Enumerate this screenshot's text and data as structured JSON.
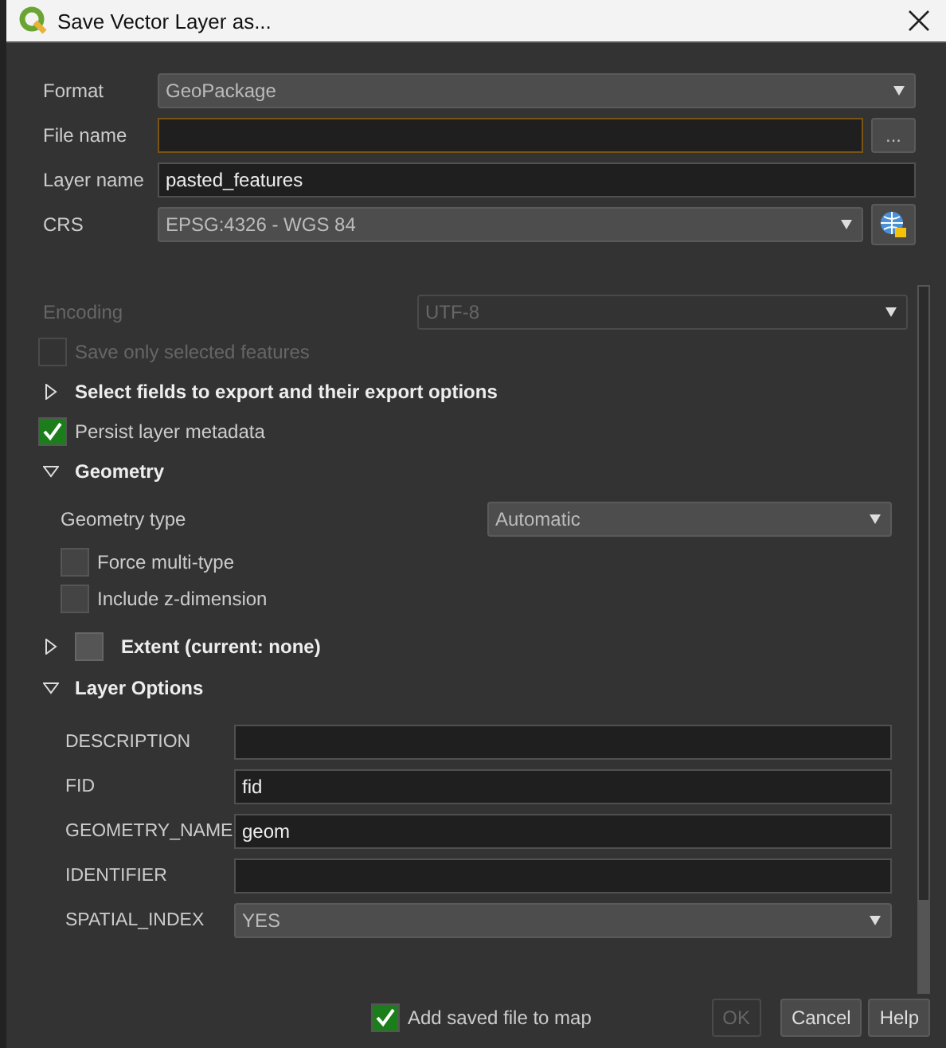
{
  "window": {
    "title": "Save Vector Layer as..."
  },
  "top_fields": [
    {
      "kind": "combo",
      "label": "Format",
      "value": "GeoPackage"
    },
    {
      "kind": "file",
      "label": "File name",
      "button": "..."
    },
    {
      "kind": "text",
      "label": "Layer name",
      "value": "pasted_features"
    },
    {
      "kind": "crs",
      "label": "CRS",
      "value": "EPSG:4326 - WGS 84"
    }
  ],
  "options": [
    {
      "kind": "combo",
      "label": "Encoding",
      "value": "UTF-8",
      "disabled": true
    },
    {
      "kind": "checkbox",
      "label": "Save only selected features",
      "checked": false,
      "disabled": true
    },
    {
      "kind": "group",
      "label": "Select fields to export and their export options",
      "expanded": false
    },
    {
      "kind": "checkbox",
      "label": "Persist layer metadata",
      "checked": true
    },
    {
      "kind": "group",
      "label": "Geometry",
      "expanded": true,
      "children": [
        {
          "kind": "combo",
          "label": "Geometry type",
          "value": "Automatic"
        },
        {
          "kind": "checkbox",
          "label": "Force multi-type",
          "checked": false
        },
        {
          "kind": "checkbox",
          "label": "Include z-dimension",
          "checked": false
        }
      ]
    },
    {
      "kind": "checkgroup",
      "label": "Extent (current: none)",
      "expanded": false,
      "checked": false
    },
    {
      "kind": "group",
      "label": "Layer Options",
      "expanded": true,
      "children": [
        {
          "kind": "field",
          "label": "DESCRIPTION"
        },
        {
          "kind": "field",
          "label": "FID",
          "value": "fid"
        },
        {
          "kind": "field",
          "label": "GEOMETRY_NAME",
          "value": "geom"
        },
        {
          "kind": "field",
          "label": "IDENTIFIER"
        },
        {
          "kind": "field_combo",
          "label": "SPATIAL_INDEX",
          "value": "YES"
        }
      ]
    }
  ],
  "footer": {
    "add_to_map": {
      "label": "Add saved file to map",
      "checked": true
    },
    "buttons": [
      {
        "label": "OK",
        "disabled": true
      },
      {
        "label": "Cancel",
        "disabled": false
      },
      {
        "label": "Help",
        "disabled": false
      }
    ]
  }
}
